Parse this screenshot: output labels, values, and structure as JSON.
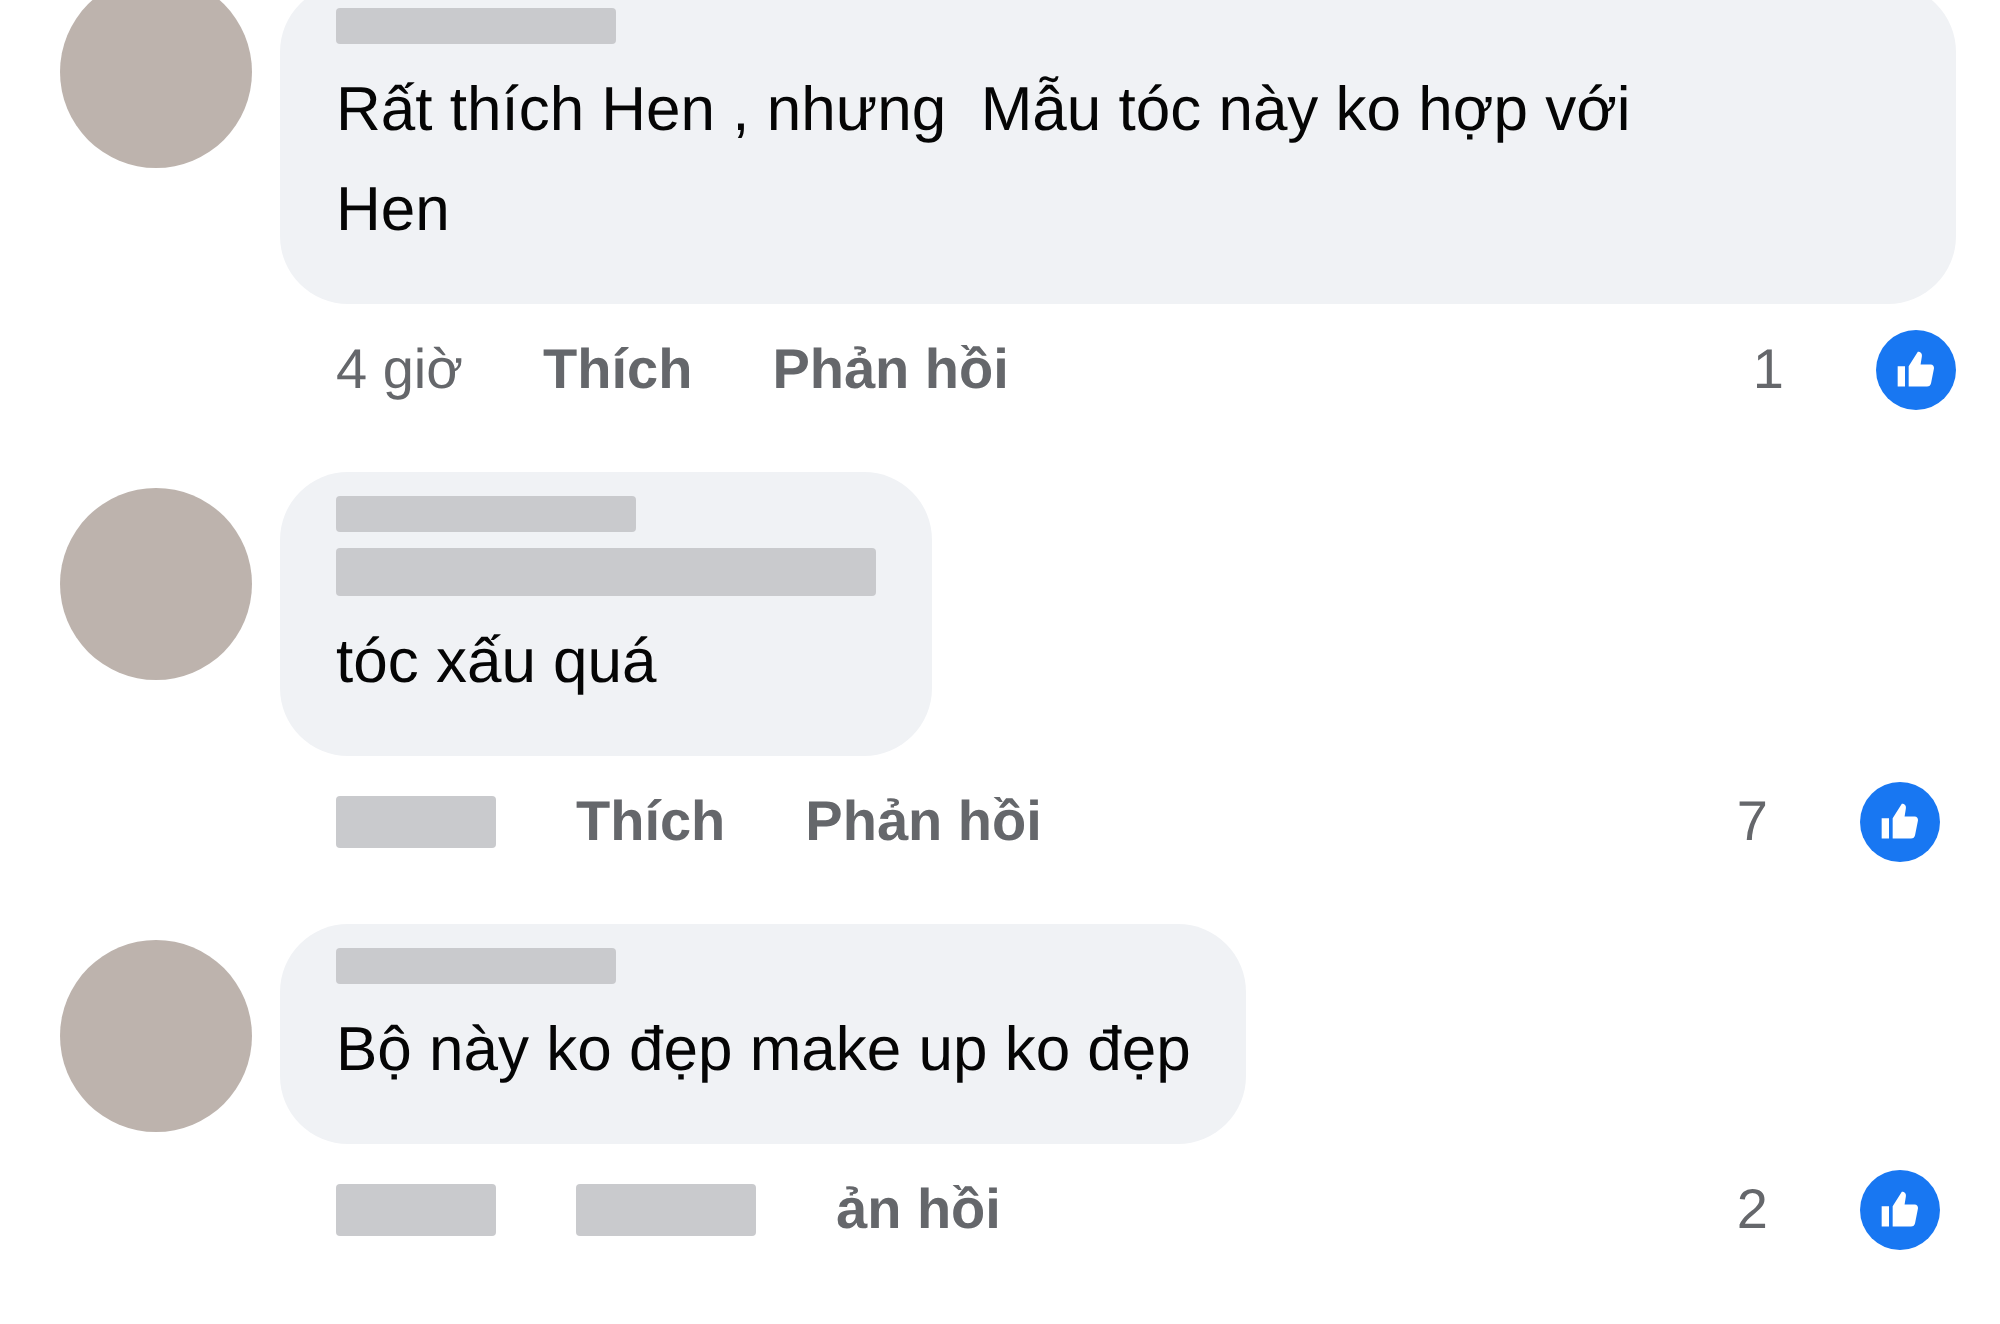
{
  "comments": [
    {
      "text": "Rất thích Hen , nhưng  Mẫu tóc này ko hợp với Hen",
      "time": "4 giờ",
      "actions": [
        {
          "kind": "text",
          "label": "Thích"
        },
        {
          "kind": "text",
          "label": "Phản hồi"
        }
      ],
      "like_count": "1"
    },
    {
      "text": "tóc xấu quá",
      "actions": [
        {
          "kind": "text",
          "label": "Thích"
        },
        {
          "kind": "text",
          "label": "Phản hồi"
        }
      ],
      "like_count": "7"
    },
    {
      "text": "Bộ này ko đẹp make up ko đẹp",
      "actions": [
        {
          "kind": "blurred"
        },
        {
          "kind": "text",
          "label": "ản hồi"
        }
      ],
      "like_count": "2"
    }
  ]
}
